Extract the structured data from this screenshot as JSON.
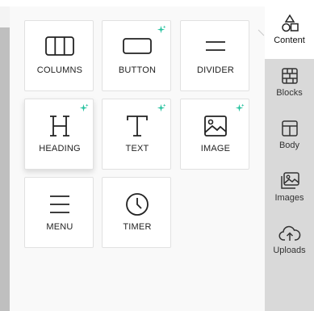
{
  "colors": {
    "sparkle": "#27c29f",
    "sidebar_bg": "#d9d9d9",
    "active_tab_bg": "#ffffff",
    "icon_stroke": "#222222"
  },
  "tools": [
    {
      "label": "COLUMNS",
      "icon": "columns-icon",
      "ai": false
    },
    {
      "label": "BUTTON",
      "icon": "button-icon",
      "ai": true
    },
    {
      "label": "DIVIDER",
      "icon": "divider-icon",
      "ai": false
    },
    {
      "label": "HEADING",
      "icon": "heading-icon",
      "ai": true
    },
    {
      "label": "TEXT",
      "icon": "text-icon",
      "ai": true
    },
    {
      "label": "IMAGE",
      "icon": "image-icon",
      "ai": true
    },
    {
      "label": "MENU",
      "icon": "menu-icon",
      "ai": false
    },
    {
      "label": "TIMER",
      "icon": "timer-icon",
      "ai": false
    }
  ],
  "sidebar": {
    "tabs": [
      {
        "label": "Content",
        "icon": "shapes-icon",
        "active": true
      },
      {
        "label": "Blocks",
        "icon": "blocks-icon",
        "active": false
      },
      {
        "label": "Body",
        "icon": "body-layout-icon",
        "active": false
      },
      {
        "label": "Images",
        "icon": "images-icon",
        "active": false
      },
      {
        "label": "Uploads",
        "icon": "cloud-upload-icon",
        "active": false
      }
    ]
  }
}
